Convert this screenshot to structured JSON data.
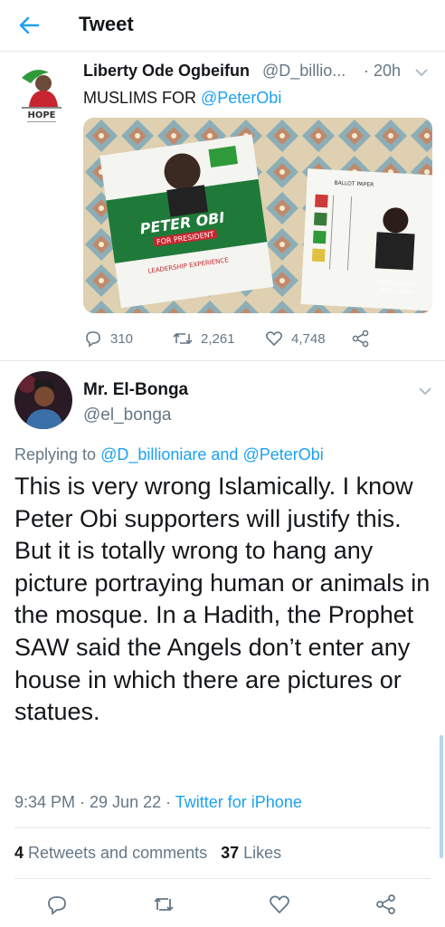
{
  "header": {
    "title": "Tweet",
    "back_icon": "arrow-left-icon"
  },
  "quoted_tweet": {
    "avatar_text": "HOPE",
    "name": "Liberty Ode Ogbeifun",
    "handle": "@D_billio...",
    "time": "· 20h",
    "text_prefix": "MUSLIMS FOR ",
    "text_mention": "@PeterObi",
    "image": {
      "poster_name": "PETER OBI",
      "poster_sub": "FOR PRESIDENT",
      "poster_tag": "LEADERSHIP EXPERIENCE",
      "ballot_header": "BALLOT PAPER",
      "ballot_footer": "PETER OBI 20",
      "ballot_footer2": "VOTE LABOU"
    },
    "actions": {
      "replies": "310",
      "retweets": "2,261",
      "likes": "4,748"
    }
  },
  "main_tweet": {
    "name": "Mr. El-Bonga",
    "handle": "@el_bonga",
    "replying_prefix": "Replying to ",
    "reply_to_1": "@D_billioniare",
    "reply_and": " and ",
    "reply_to_2": "@PeterObi",
    "body": "This is very wrong Islamically. I know Peter Obi supporters will justify this. But it is totally wrong to hang any picture portraying human or animals in the mosque. In a Hadith, the Prophet SAW said the Angels don’t enter any house in which there are pictures or statues.",
    "time": "9:34 PM · 29 Jun 22 · ",
    "source": "Twitter for iPhone",
    "retweets_count": "4",
    "retweets_label": " Retweets and comments",
    "likes_count": "37",
    "likes_label": " Likes"
  },
  "colors": {
    "link": "#1da1f2",
    "muted": "#657786",
    "text": "#14171a",
    "divider": "#e1e8ed"
  }
}
